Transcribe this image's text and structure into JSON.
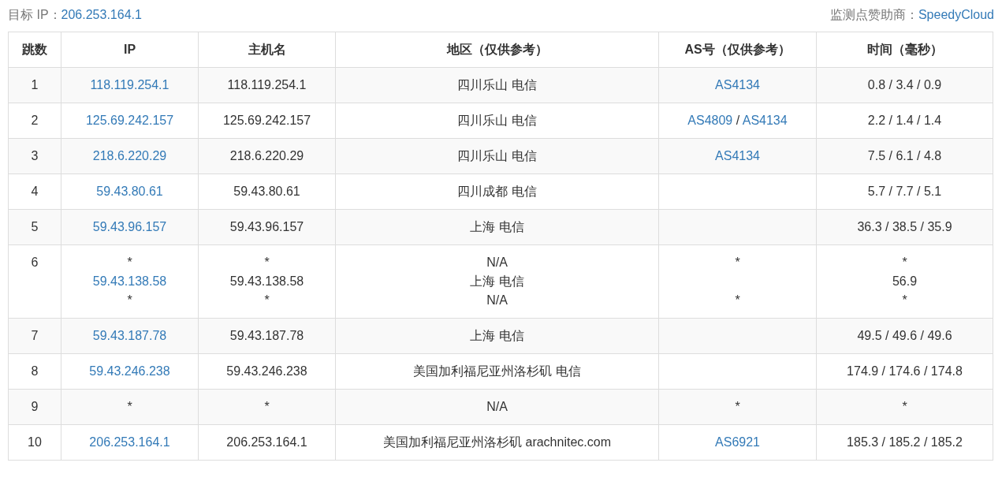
{
  "target": {
    "label": "目标 IP：",
    "value": "206.253.164.1"
  },
  "sponsor": {
    "label": "监测点赞助商：",
    "value": "SpeedyCloud"
  },
  "table": {
    "columns": [
      "跳数",
      "IP",
      "主机名",
      "地区（仅供参考）",
      "AS号（仅供参考）",
      "时间（毫秒）"
    ],
    "rows": [
      {
        "hop": "1",
        "ip": [
          [
            {
              "kind": "link",
              "text": "118.119.254.1"
            }
          ]
        ],
        "host": [
          [
            {
              "kind": "text",
              "text": "118.119.254.1"
            }
          ]
        ],
        "region": [
          [
            {
              "kind": "text",
              "text": "四川乐山 电信"
            }
          ]
        ],
        "as": [
          [
            {
              "kind": "link",
              "text": "AS4134"
            }
          ]
        ],
        "time": [
          [
            {
              "kind": "text",
              "text": "0.8 / 3.4 / 0.9"
            }
          ]
        ]
      },
      {
        "hop": "2",
        "ip": [
          [
            {
              "kind": "link",
              "text": "125.69.242.157"
            }
          ]
        ],
        "host": [
          [
            {
              "kind": "text",
              "text": "125.69.242.157"
            }
          ]
        ],
        "region": [
          [
            {
              "kind": "text",
              "text": "四川乐山 电信"
            }
          ]
        ],
        "as": [
          [
            {
              "kind": "link",
              "text": "AS4809"
            },
            {
              "kind": "text",
              "text": " / "
            },
            {
              "kind": "link",
              "text": "AS4134"
            }
          ]
        ],
        "time": [
          [
            {
              "kind": "text",
              "text": "2.2 / 1.4 / 1.4"
            }
          ]
        ]
      },
      {
        "hop": "3",
        "ip": [
          [
            {
              "kind": "link",
              "text": "218.6.220.29"
            }
          ]
        ],
        "host": [
          [
            {
              "kind": "text",
              "text": "218.6.220.29"
            }
          ]
        ],
        "region": [
          [
            {
              "kind": "text",
              "text": "四川乐山 电信"
            }
          ]
        ],
        "as": [
          [
            {
              "kind": "link",
              "text": "AS4134"
            }
          ]
        ],
        "time": [
          [
            {
              "kind": "text",
              "text": "7.5 / 6.1 / 4.8"
            }
          ]
        ]
      },
      {
        "hop": "4",
        "ip": [
          [
            {
              "kind": "link",
              "text": "59.43.80.61"
            }
          ]
        ],
        "host": [
          [
            {
              "kind": "text",
              "text": "59.43.80.61"
            }
          ]
        ],
        "region": [
          [
            {
              "kind": "text",
              "text": "四川成都 电信"
            }
          ]
        ],
        "time": [
          [
            {
              "kind": "text",
              "text": "5.7 / 7.7 / 5.1"
            }
          ]
        ]
      },
      {
        "hop": "5",
        "ip": [
          [
            {
              "kind": "link",
              "text": "59.43.96.157"
            }
          ]
        ],
        "host": [
          [
            {
              "kind": "text",
              "text": "59.43.96.157"
            }
          ]
        ],
        "region": [
          [
            {
              "kind": "text",
              "text": "上海 电信"
            }
          ]
        ],
        "time": [
          [
            {
              "kind": "text",
              "text": "36.3 / 38.5 / 35.9"
            }
          ]
        ]
      },
      {
        "hop": "6",
        "ip": [
          [
            {
              "kind": "text",
              "text": "*"
            }
          ],
          [
            {
              "kind": "link",
              "text": "59.43.138.58"
            }
          ],
          [
            {
              "kind": "text",
              "text": "*"
            }
          ]
        ],
        "host": [
          [
            {
              "kind": "text",
              "text": "*"
            }
          ],
          [
            {
              "kind": "text",
              "text": "59.43.138.58"
            }
          ],
          [
            {
              "kind": "text",
              "text": "*"
            }
          ]
        ],
        "region": [
          [
            {
              "kind": "text",
              "text": "N/A"
            }
          ],
          [
            {
              "kind": "text",
              "text": "上海 电信"
            }
          ],
          [
            {
              "kind": "text",
              "text": "N/A"
            }
          ]
        ],
        "as": [
          [
            {
              "kind": "text",
              "text": "*"
            }
          ],
          [
            {
              "kind": "gap"
            }
          ],
          [
            {
              "kind": "text",
              "text": "*"
            }
          ]
        ],
        "time": [
          [
            {
              "kind": "text",
              "text": "*"
            }
          ],
          [
            {
              "kind": "text",
              "text": "56.9"
            }
          ],
          [
            {
              "kind": "text",
              "text": "*"
            }
          ]
        ]
      },
      {
        "hop": "7",
        "ip": [
          [
            {
              "kind": "link",
              "text": "59.43.187.78"
            }
          ]
        ],
        "host": [
          [
            {
              "kind": "text",
              "text": "59.43.187.78"
            }
          ]
        ],
        "region": [
          [
            {
              "kind": "text",
              "text": "上海 电信"
            }
          ]
        ],
        "time": [
          [
            {
              "kind": "text",
              "text": "49.5 / 49.6 / 49.6"
            }
          ]
        ]
      },
      {
        "hop": "8",
        "ip": [
          [
            {
              "kind": "link",
              "text": "59.43.246.238"
            }
          ]
        ],
        "host": [
          [
            {
              "kind": "text",
              "text": "59.43.246.238"
            }
          ]
        ],
        "region": [
          [
            {
              "kind": "text",
              "text": "美国加利福尼亚州洛杉矶 电信"
            }
          ]
        ],
        "time": [
          [
            {
              "kind": "text",
              "text": "174.9 / 174.6 / 174.8"
            }
          ]
        ]
      },
      {
        "hop": "9",
        "ip": [
          [
            {
              "kind": "text",
              "text": "*"
            }
          ]
        ],
        "host": [
          [
            {
              "kind": "text",
              "text": "*"
            }
          ]
        ],
        "region": [
          [
            {
              "kind": "text",
              "text": "N/A"
            }
          ]
        ],
        "as": [
          [
            {
              "kind": "text",
              "text": "*"
            }
          ]
        ],
        "time": [
          [
            {
              "kind": "text",
              "text": "*"
            }
          ]
        ]
      },
      {
        "hop": "10",
        "ip": [
          [
            {
              "kind": "link",
              "text": "206.253.164.1"
            }
          ]
        ],
        "host": [
          [
            {
              "kind": "text",
              "text": "206.253.164.1"
            }
          ]
        ],
        "region": [
          [
            {
              "kind": "text",
              "text": "美国加利福尼亚州洛杉矶 arachnitec.com"
            }
          ]
        ],
        "as": [
          [
            {
              "kind": "link",
              "text": "AS6921"
            }
          ]
        ],
        "time": [
          [
            {
              "kind": "text",
              "text": "185.3 / 185.2 / 185.2"
            }
          ]
        ]
      }
    ]
  }
}
